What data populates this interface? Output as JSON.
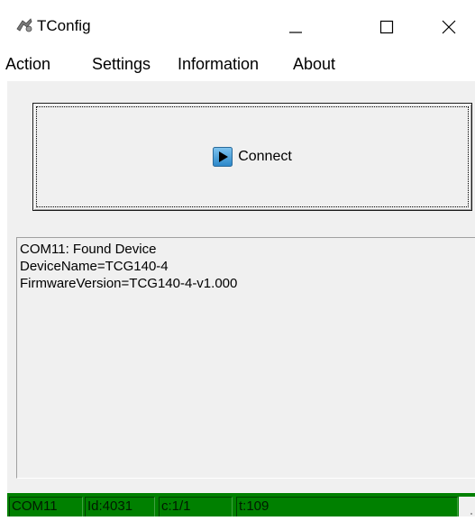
{
  "window": {
    "title": "TConfig"
  },
  "menu": {
    "items": [
      {
        "label": "Action"
      },
      {
        "label": "Settings"
      },
      {
        "label": "Information"
      },
      {
        "label": "About"
      }
    ]
  },
  "connect": {
    "label": "Connect",
    "icon": "play-icon"
  },
  "log": {
    "lines": [
      "COM11: Found Device",
      "DeviceName=TCG140-4",
      "FirmwareVersion=TCG140-4-v1.000"
    ]
  },
  "status": {
    "port": "COM11",
    "id": "Id:4031",
    "c": "c:1/1",
    "t": "t:109",
    "color": "#008000"
  }
}
